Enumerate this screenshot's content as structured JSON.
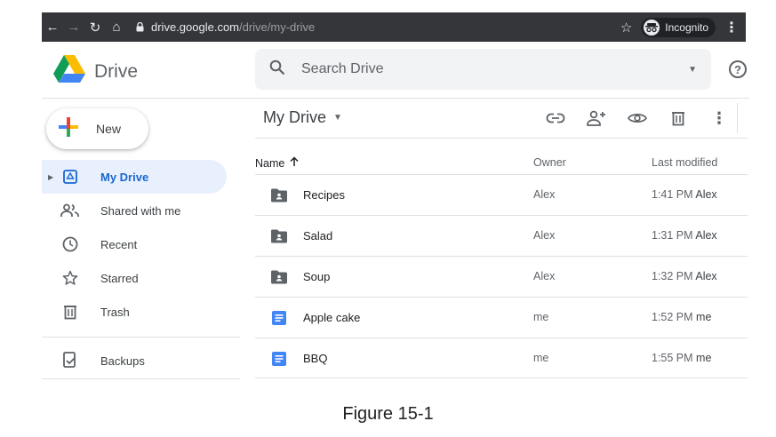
{
  "browser": {
    "url_host": "drive.google.com",
    "url_path": "/drive/my-drive",
    "incognito_label": "Incognito"
  },
  "app": {
    "name": "Drive",
    "search_placeholder": "Search Drive",
    "help_glyph": "?"
  },
  "sidebar": {
    "new_label": "New",
    "items": [
      {
        "label": "My Drive",
        "icon": "my-drive-icon"
      },
      {
        "label": "Shared with me",
        "icon": "shared-icon"
      },
      {
        "label": "Recent",
        "icon": "clock-icon"
      },
      {
        "label": "Starred",
        "icon": "star-icon"
      },
      {
        "label": "Trash",
        "icon": "trash-icon"
      },
      {
        "label": "Backups",
        "icon": "backups-icon"
      }
    ]
  },
  "main": {
    "breadcrumb": "My Drive",
    "columns": {
      "name": "Name",
      "owner": "Owner",
      "modified": "Last modified"
    },
    "files": [
      {
        "name": "Recipes",
        "type": "shared-folder",
        "owner": "Alex",
        "modified": "1:41 PM",
        "modified_by": "Alex"
      },
      {
        "name": "Salad",
        "type": "shared-folder",
        "owner": "Alex",
        "modified": "1:31 PM",
        "modified_by": "Alex"
      },
      {
        "name": "Soup",
        "type": "shared-folder",
        "owner": "Alex",
        "modified": "1:32 PM",
        "modified_by": "Alex"
      },
      {
        "name": "Apple cake",
        "type": "doc",
        "owner": "me",
        "modified": "1:52 PM",
        "modified_by": "me"
      },
      {
        "name": "BBQ",
        "type": "doc",
        "owner": "me",
        "modified": "1:55 PM",
        "modified_by": "me"
      }
    ]
  },
  "caption": "Figure 15-1",
  "colors": {
    "chrome_bg": "#35363a",
    "active_bg": "#e8f0fe",
    "active_text": "#1967d2",
    "doc_blue": "#4285f4",
    "folder_gray": "#5f6368"
  }
}
